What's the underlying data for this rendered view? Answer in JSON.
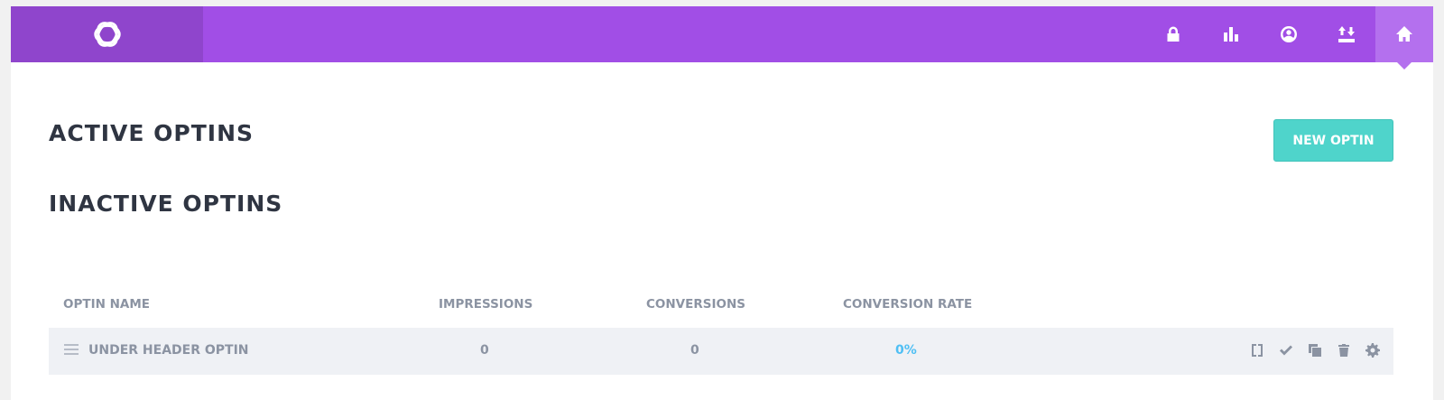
{
  "header": {
    "nav": [
      {
        "icon": "lock-icon"
      },
      {
        "icon": "bar-chart-icon"
      },
      {
        "icon": "account-icon"
      },
      {
        "icon": "import-export-icon"
      },
      {
        "icon": "home-icon"
      }
    ]
  },
  "main": {
    "active_title": "ACTIVE OPTINS",
    "inactive_title": "INACTIVE OPTINS",
    "new_optin_label": "NEW OPTIN"
  },
  "table": {
    "headers": {
      "name": "OPTIN NAME",
      "impressions": "IMPRESSIONS",
      "conversions": "CONVERSIONS",
      "rate": "CONVERSION RATE"
    },
    "rows": [
      {
        "name": "UNDER HEADER OPTIN",
        "impressions": "0",
        "conversions": "0",
        "rate": "0%"
      }
    ]
  },
  "colors": {
    "header_bg": "#a14ee6",
    "logo_bg": "#8f45cc",
    "accent_teal": "#4fd4cb",
    "rate_blue": "#4fbff4"
  }
}
